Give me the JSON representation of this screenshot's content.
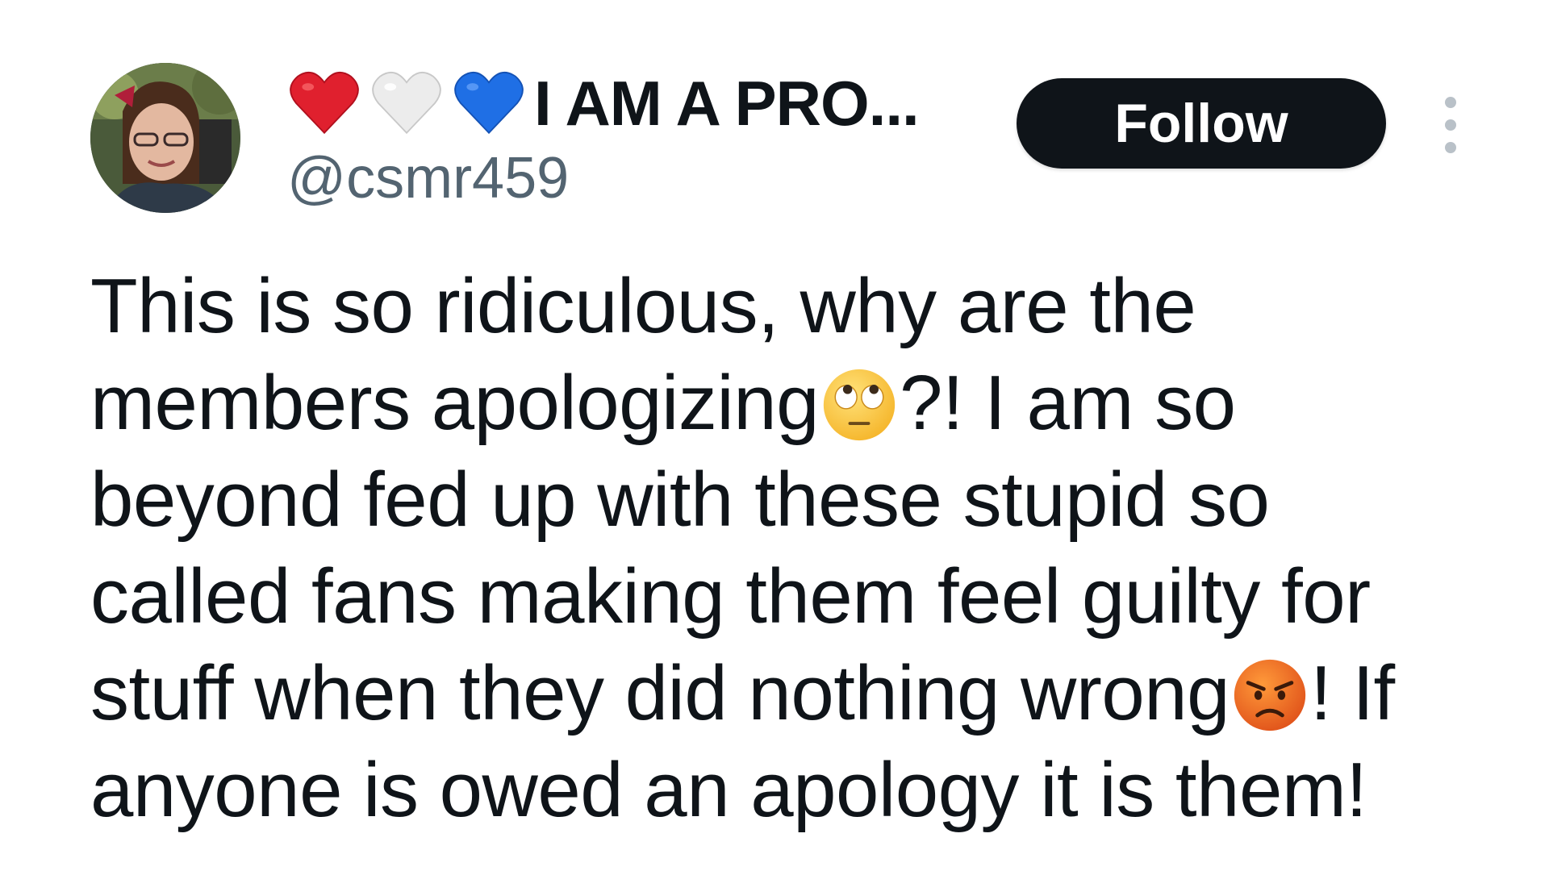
{
  "user": {
    "display_name": "I AM A PRO...",
    "name_hearts": [
      "red-heart",
      "white-heart",
      "blue-heart"
    ],
    "handle": "@csmr459",
    "avatar_icon": "profile-photo"
  },
  "actions": {
    "follow_label": "Follow",
    "more_icon": "vertical-ellipsis-icon"
  },
  "tweet": {
    "line1": "This is so ridiculous, why are the",
    "line2_a": "members apologizing",
    "line2_b": "?!  I am so",
    "line3": "beyond fed up with these stupid so",
    "line4": "called fans making them feel guilty for",
    "line5_a": "stuff when they did nothing wrong",
    "line5_b": "! If",
    "line6": "anyone is owed an apology it is them!",
    "emoji_1": "face-with-rolling-eyes",
    "emoji_2": "angry-face"
  },
  "colors": {
    "text": "#0f1419",
    "secondary_text": "#536471",
    "button_bg": "#0f1419",
    "button_text": "#ffffff",
    "heart_red": "#e0202e",
    "heart_white": "#e8e8e8",
    "heart_blue": "#1f6fe5"
  }
}
